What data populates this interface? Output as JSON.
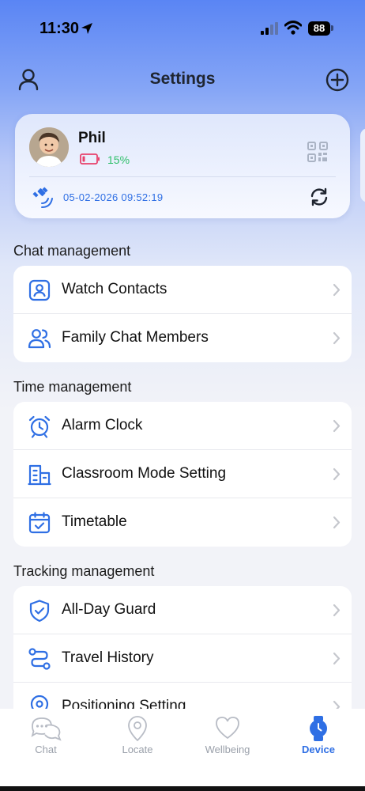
{
  "status_bar": {
    "time": "11:30",
    "battery": "88"
  },
  "nav": {
    "title": "Settings"
  },
  "device": {
    "name": "Phil",
    "battery_percent": "15%",
    "last_update": "05-02-2026 09:52:19"
  },
  "sections": [
    {
      "title": "Chat management",
      "items": [
        {
          "label": "Watch Contacts",
          "icon": "contact-card-icon"
        },
        {
          "label": "Family Chat Members",
          "icon": "group-icon"
        }
      ]
    },
    {
      "title": "Time management",
      "items": [
        {
          "label": "Alarm Clock",
          "icon": "alarm-clock-icon"
        },
        {
          "label": "Classroom Mode Setting",
          "icon": "building-icon"
        },
        {
          "label": "Timetable",
          "icon": "calendar-icon"
        }
      ]
    },
    {
      "title": "Tracking management",
      "items": [
        {
          "label": "All-Day Guard",
          "icon": "shield-check-icon"
        },
        {
          "label": "Travel History",
          "icon": "route-icon"
        },
        {
          "label": "Positioning Setting",
          "icon": "location-pin-icon"
        }
      ]
    }
  ],
  "tabs": [
    {
      "label": "Chat",
      "icon": "chat-bubbles-icon",
      "active": false
    },
    {
      "label": "Locate",
      "icon": "map-pin-icon",
      "active": false
    },
    {
      "label": "Wellbeing",
      "icon": "heart-icon",
      "active": false
    },
    {
      "label": "Device",
      "icon": "watch-icon",
      "active": true
    }
  ],
  "colors": {
    "accent": "#2f6fe4",
    "battery_low": "#e8416b",
    "battery_text": "#2fbf6a",
    "header_gradient_top": "#5a85f4"
  }
}
